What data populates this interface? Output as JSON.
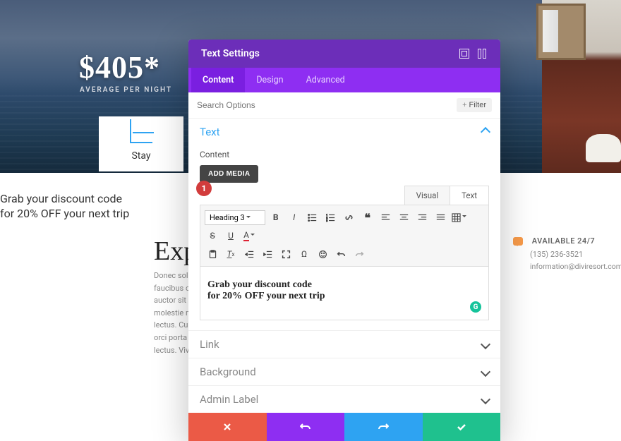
{
  "hero": {
    "price": "$405*",
    "avg_label": "AVERAGE PER NIGHT",
    "stay_label": "Stay"
  },
  "cta": {
    "line1": "Grab your discount code",
    "line2": "for 20% OFF your next trip"
  },
  "page": {
    "exp_title": "Exp",
    "lorem": "Donec sollicit faucibus orci auctor sit am molestie mal lectus. Curab id orci porta ac lectus. Vivi"
  },
  "contact": {
    "available": "AVAILABLE 24/7",
    "phone": "(135) 236-3521",
    "email": "information@diviresort.com"
  },
  "modal": {
    "title": "Text Settings",
    "tabs": {
      "content": "Content",
      "design": "Design",
      "advanced": "Advanced"
    },
    "search_placeholder": "Search Options",
    "filter_label": "Filter",
    "section_text": "Text",
    "content_label": "Content",
    "add_media": "ADD MEDIA",
    "editor_tabs": {
      "visual": "Visual",
      "text": "Text"
    },
    "format_label": "Heading 3",
    "editor": {
      "line1": "Grab your discount code",
      "line2": "for 20% OFF your next trip"
    },
    "sections": {
      "link": "Link",
      "background": "Background",
      "admin": "Admin Label"
    }
  },
  "badge_number": "1"
}
